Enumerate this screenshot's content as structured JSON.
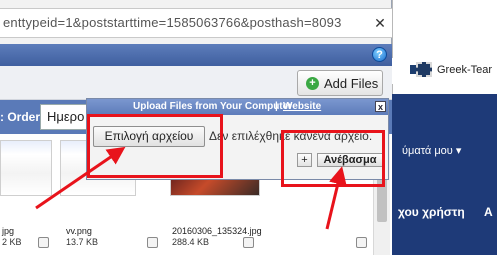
{
  "background_page": {
    "bookmark_label": "Greek-Tear",
    "nav_menu_label": "ύματά μου",
    "nav_menu_arrow": "▾",
    "nav_title": "χου χρήστη",
    "nav_title_cut": "Α",
    "nav_bg_color": "#1e3a78"
  },
  "popup": {
    "url": "enttypeid=1&poststarttime=1585063766&posthash=8093",
    "close_glyph": "✕",
    "help_glyph": "?",
    "toolbar": {
      "add_files_label": "Add Files",
      "add_icon_glyph": "+"
    },
    "order": {
      "label": ": Order:",
      "selected": "Ημερο"
    },
    "files": [
      {
        "name": "jpg",
        "size": "2 KB",
        "thumb": "screenshot"
      },
      {
        "name": "vv.png",
        "size": "13.7 KB",
        "thumb": "screenshot"
      },
      {
        "name": "20160306_135324.jpg",
        "size": "288.4 KB",
        "thumb": "photo"
      }
    ]
  },
  "upload_dialog": {
    "title": "Upload Files from Your Computer",
    "separator": "|",
    "website_link": "Website",
    "close_glyph": "x",
    "choose_file_label": "Επιλογή αρχείου",
    "no_file_text": "Δεν επιλέχθηκε κανένα αρχείο.",
    "plus_label": "+",
    "upload_label": "Ανέβασμα"
  },
  "colors": {
    "annotation_red": "#e8131b",
    "header_blue": "#5d7dbb"
  }
}
